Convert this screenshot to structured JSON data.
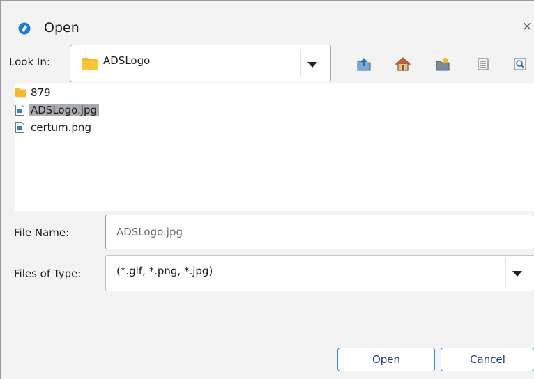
{
  "dialog": {
    "title": "Open",
    "close_glyph": "×"
  },
  "look_in": {
    "label": "Look In:",
    "value": "ADSLogo"
  },
  "toolbar": {
    "icons": [
      "up-one-level-icon",
      "home-icon",
      "new-folder-icon",
      "list-view-icon",
      "details-view-icon"
    ]
  },
  "files": [
    {
      "name": "879",
      "type": "folder",
      "selected": false
    },
    {
      "name": "ADSLogo.jpg",
      "type": "image-file",
      "selected": true
    },
    {
      "name": "certum.png",
      "type": "image-file",
      "selected": false
    }
  ],
  "file_name": {
    "label": "File Name:",
    "value": "ADSLogo.jpg"
  },
  "file_type": {
    "label": "Files of Type:",
    "value": "(*.gif, *.png, *.jpg)"
  },
  "buttons": {
    "open": "Open",
    "cancel": "Cancel"
  },
  "colors": {
    "accent": "#2f86d5",
    "folder": "#f5b924",
    "selection": "#a9acb0"
  }
}
